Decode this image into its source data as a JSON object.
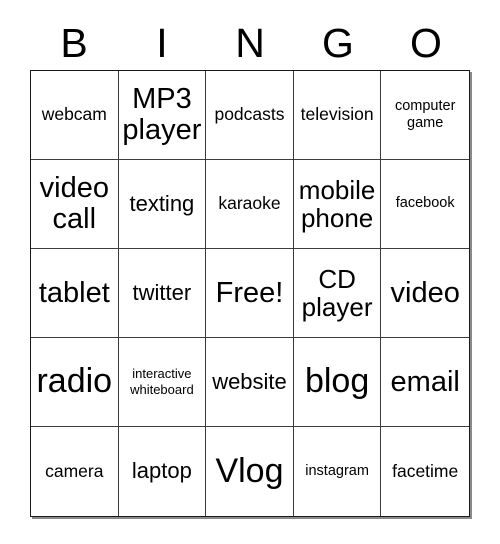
{
  "card": {
    "title_letters": [
      "B",
      "I",
      "N",
      "G",
      "O"
    ],
    "free_space_label": "Free!",
    "colors": {
      "background": "#ffffff",
      "text": "#000000",
      "grid_line": "#3c3c3c",
      "outer_border": "#1a1a1a",
      "shadow": "#8a8a8a"
    },
    "rows": [
      [
        {
          "label": "webcam",
          "size": "md"
        },
        {
          "label": "MP3 player",
          "size": "2xl"
        },
        {
          "label": "podcasts",
          "size": "md"
        },
        {
          "label": "television",
          "size": "md"
        },
        {
          "label": "computer game",
          "size": "sm"
        }
      ],
      [
        {
          "label": "video call",
          "size": "2xl"
        },
        {
          "label": "texting",
          "size": "lg"
        },
        {
          "label": "karaoke",
          "size": "md"
        },
        {
          "label": "mobile phone",
          "size": "xl"
        },
        {
          "label": "facebook",
          "size": "sm"
        }
      ],
      [
        {
          "label": "tablet",
          "size": "2xl"
        },
        {
          "label": "twitter",
          "size": "lg"
        },
        {
          "label": "Free!",
          "size": "2xl"
        },
        {
          "label": "CD player",
          "size": "xl"
        },
        {
          "label": "video",
          "size": "2xl"
        }
      ],
      [
        {
          "label": "radio",
          "size": "3xl"
        },
        {
          "label": "interactive whiteboard",
          "size": "xs"
        },
        {
          "label": "website",
          "size": "lg"
        },
        {
          "label": "blog",
          "size": "3xl"
        },
        {
          "label": "email",
          "size": "2xl"
        }
      ],
      [
        {
          "label": "camera",
          "size": "md"
        },
        {
          "label": "laptop",
          "size": "lg"
        },
        {
          "label": "Vlog",
          "size": "3xl"
        },
        {
          "label": "instagram",
          "size": "sm"
        },
        {
          "label": "facetime",
          "size": "md"
        }
      ]
    ]
  }
}
